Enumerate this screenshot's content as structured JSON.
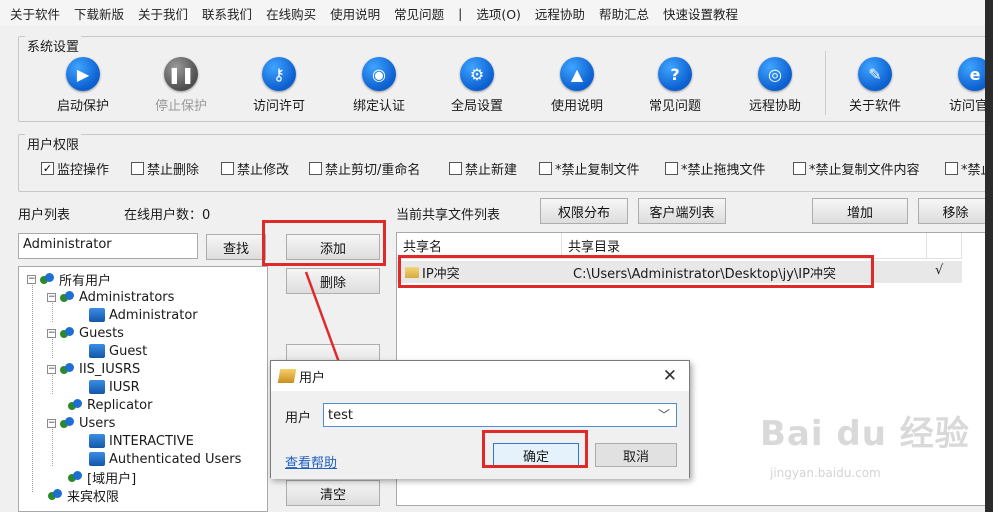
{
  "menu": [
    "关于软件",
    "下载新版",
    "关于我们",
    "联系我们",
    "在线购买",
    "使用说明",
    "常见问题",
    "|",
    "选项(O)",
    "远程协助",
    "帮助汇总",
    "快速设置教程"
  ],
  "system": {
    "title": "系统设置",
    "buttons": [
      {
        "label": "启动保护",
        "icon": "play-icon",
        "glyph": "▶"
      },
      {
        "label": "停止保护",
        "icon": "pause-icon",
        "glyph": "❚❚",
        "disabled": true
      },
      {
        "label": "访问许可",
        "icon": "key-icon",
        "glyph": "⚷"
      },
      {
        "label": "绑定认证",
        "icon": "shield-icon",
        "glyph": "◉"
      },
      {
        "label": "全局设置",
        "icon": "gear-icon",
        "glyph": "⚙"
      },
      {
        "label": "使用说明",
        "icon": "graduation-cap-icon",
        "glyph": "▲"
      },
      {
        "label": "常见问题",
        "icon": "question-icon",
        "glyph": "?"
      },
      {
        "label": "远程协助",
        "icon": "globe-icon",
        "glyph": "◎"
      },
      {
        "label": "关于软件",
        "icon": "edit-icon",
        "glyph": "✎"
      },
      {
        "label": "访问官网",
        "icon": "ie-icon",
        "glyph": "e"
      }
    ]
  },
  "permissions": {
    "title": "用户权限",
    "items": [
      {
        "label": "监控操作",
        "checked": true
      },
      {
        "label": "禁止删除",
        "checked": false
      },
      {
        "label": "禁止修改",
        "checked": false
      },
      {
        "label": "禁止剪切/重命名",
        "checked": false
      },
      {
        "label": "禁止新建",
        "checked": false
      },
      {
        "label": "*禁止复制文件",
        "checked": false
      },
      {
        "label": "*禁止拖拽文件",
        "checked": false
      },
      {
        "label": "*禁止复制文件内容",
        "checked": false
      },
      {
        "label": "*禁止",
        "checked": false
      }
    ]
  },
  "users": {
    "list_label": "用户列表",
    "online_label": "在线用户数：0",
    "search_value": "Administrator",
    "search_button": "查找"
  },
  "actions": {
    "add": "添加",
    "delete": "删除",
    "clear": "清空"
  },
  "tree": {
    "root": "所有用户",
    "nodes": [
      {
        "label": "Administrators",
        "type": "group"
      },
      {
        "label": "Administrator",
        "type": "user"
      },
      {
        "label": "Guests",
        "type": "group"
      },
      {
        "label": "Guest",
        "type": "user"
      },
      {
        "label": "IIS_IUSRS",
        "type": "group"
      },
      {
        "label": "IUSR",
        "type": "user"
      },
      {
        "label": "Replicator",
        "type": "group"
      },
      {
        "label": "Users",
        "type": "group"
      },
      {
        "label": "INTERACTIVE",
        "type": "user"
      },
      {
        "label": "Authenticated Users",
        "type": "user"
      },
      {
        "label": "[域用户]",
        "type": "group"
      },
      {
        "label": "来宾权限",
        "type": "group"
      }
    ]
  },
  "share": {
    "title": "当前共享文件列表",
    "tab_perm": "权限分布",
    "tab_client": "客户端列表",
    "add": "增加",
    "remove": "移除",
    "col_name": "共享名",
    "col_dir": "共享目录",
    "rows": [
      {
        "name": "IP冲突",
        "dir": "C:\\Users\\Administrator\\Desktop\\jy\\IP冲突",
        "mark": "√"
      }
    ]
  },
  "dialog": {
    "title": "用户",
    "close": "✕",
    "field_label": "用户",
    "field_value": "test",
    "help_link": "查看帮助",
    "ok": "确定",
    "cancel": "取消"
  },
  "watermark": {
    "brand": "Bai du 经验",
    "url": "jingyan.baidu.com"
  },
  "colors": {
    "accent_blue": "#0b5fd0",
    "highlight_red": "#e02a2a"
  }
}
